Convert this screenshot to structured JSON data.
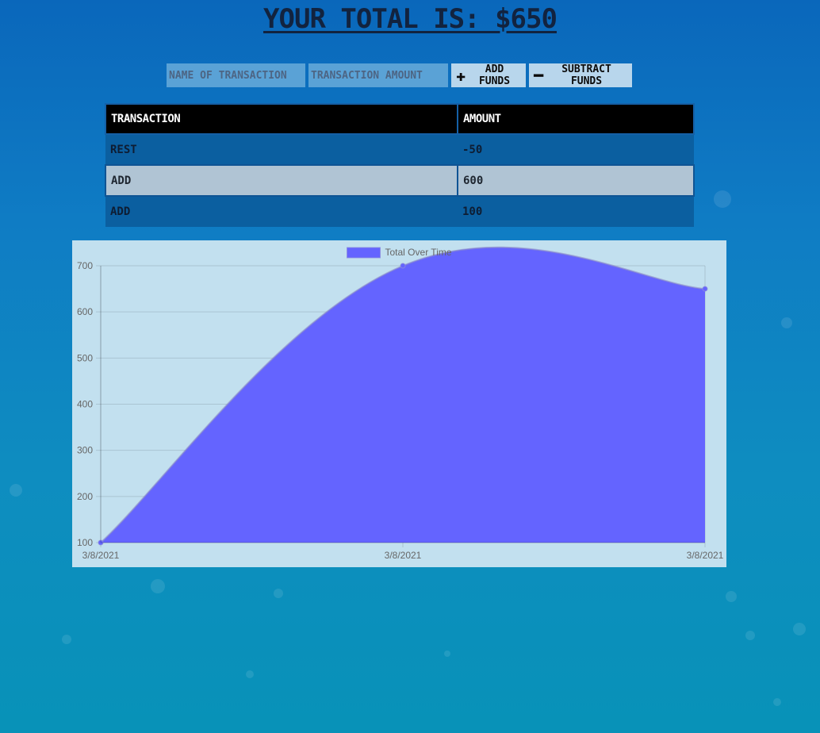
{
  "header": {
    "title": "Your Total is: $650"
  },
  "form": {
    "name_placeholder": "Name of Transaction",
    "amount_placeholder": "Transaction Amount",
    "add_label": "Add Funds",
    "add_icon": "plus-icon",
    "subtract_label": "Subtract Funds",
    "subtract_icon": "minus-icon"
  },
  "table": {
    "columns": [
      "Transaction",
      "Amount"
    ],
    "rows": [
      {
        "name": "Rest",
        "amount": "-50"
      },
      {
        "name": "Add",
        "amount": "600"
      },
      {
        "name": "Add",
        "amount": "100"
      }
    ]
  },
  "chart_data": {
    "type": "area",
    "title": "",
    "xlabel": "",
    "ylabel": "",
    "x": [
      "3/8/2021",
      "3/8/2021",
      "3/8/2021"
    ],
    "series": [
      {
        "name": "Total Over Time",
        "values": [
          100,
          700,
          650
        ],
        "color": "#6464ff"
      }
    ],
    "ylim": [
      100,
      700
    ],
    "yticks": [
      100,
      200,
      300,
      400,
      500,
      600,
      700
    ],
    "grid": true,
    "legend": "top"
  },
  "colors": {
    "title": "#12233f",
    "input_bg": "#5aa2d6",
    "button_bg": "#b8d6ec",
    "table_header_bg": "#000000",
    "row_dark": "#0b5fa0",
    "row_light": "#b0c4d4",
    "chart_bg": "#c2e0ef",
    "chart_fill": "#6464ff"
  }
}
